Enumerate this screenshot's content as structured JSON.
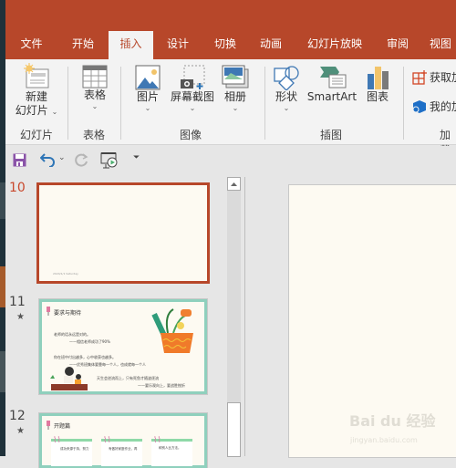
{
  "ribbon_tabs": [
    "文件",
    "开始",
    "插入",
    "设计",
    "切换",
    "动画",
    "幻灯片放映",
    "审阅",
    "视图"
  ],
  "active_tab": "插入",
  "ribbon": {
    "groups": {
      "slides": {
        "label": "幻灯片",
        "new_slide_line1": "新建",
        "new_slide_line2": "幻灯片"
      },
      "tables": {
        "label": "表格",
        "table": "表格"
      },
      "images": {
        "label": "图像",
        "picture": "图片",
        "screenshot": "屏幕截图",
        "album": "相册"
      },
      "illustrations": {
        "label": "插图",
        "shapes": "形状",
        "smartart": "SmartArt",
        "chart": "图表"
      },
      "addins": {
        "label": "加载项",
        "get_addins": "获取加载项",
        "my_addins": "我的加载项"
      }
    }
  },
  "quick_access": [
    "save-icon",
    "undo-icon",
    "redo-icon",
    "start-from-beginning-icon",
    "customize-icon"
  ],
  "thumbnails": [
    {
      "number": "10",
      "active": true,
      "has_animation": false,
      "footer_text": "2024/1/1 Saturday"
    },
    {
      "number": "11",
      "active": false,
      "has_animation": true,
      "title": "要求与期待",
      "lines": [
        "老师的话永远是对的。",
        "——相信老师成功了90%",
        "你在班中付出越多，心中收获也越多。",
        "——优秀班集体要靠每一个人，也成就每一个人",
        "天生会逆流而上，只有死鱼才随波逐流",
        "——要乐观向上，要战胜挫折"
      ]
    },
    {
      "number": "12",
      "active": false,
      "has_animation": true,
      "title": "开题篇",
      "notes": [
        "成功来源于持，努力",
        "有做好家庭作业，再",
        "和别人比方法。"
      ]
    }
  ],
  "watermark": {
    "brand": "Bai du 经验",
    "url": "jingyan.baidu.com"
  },
  "colors": {
    "accent": "#b7472a",
    "ribbon_bg": "#f3f3f3",
    "slide_bg": "#fdfaf2",
    "thumb_border": "#8fd0bd"
  }
}
